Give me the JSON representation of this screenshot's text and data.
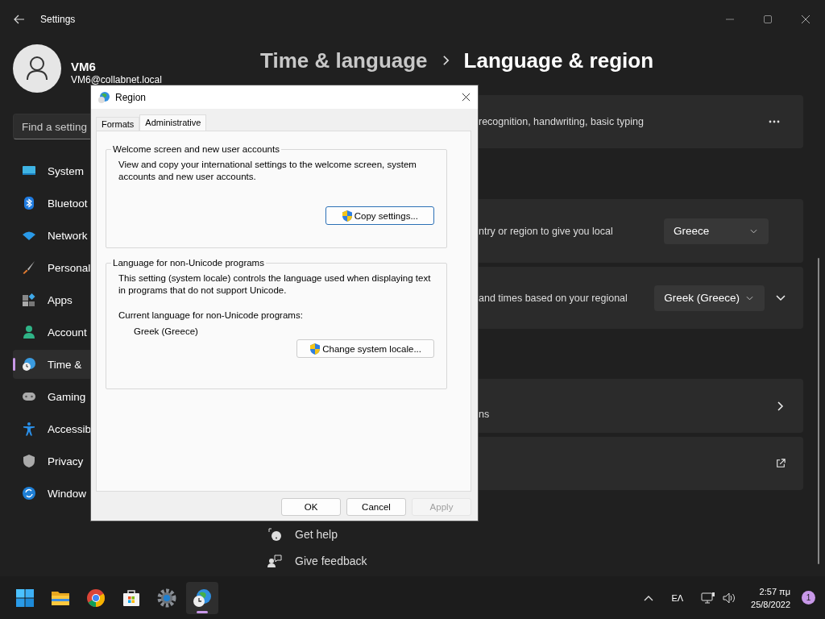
{
  "window": {
    "title": "Settings"
  },
  "user": {
    "name": "VM6",
    "email": "VM6@collabnet.local"
  },
  "search": {
    "placeholder": "Find a setting"
  },
  "nav": [
    {
      "label": "System",
      "kind": "system",
      "selected": false
    },
    {
      "label": "Bluetoot",
      "kind": "bluetooth",
      "selected": false
    },
    {
      "label": "Network",
      "kind": "network",
      "selected": false
    },
    {
      "label": "Personal",
      "kind": "brush",
      "selected": false
    },
    {
      "label": "Apps",
      "kind": "apps",
      "selected": false
    },
    {
      "label": "Account",
      "kind": "person",
      "selected": false
    },
    {
      "label": "Time &",
      "kind": "time",
      "selected": true
    },
    {
      "label": "Gaming",
      "kind": "gamepad",
      "selected": false
    },
    {
      "label": "Accessib",
      "kind": "accessibility",
      "selected": false
    },
    {
      "label": "Privacy",
      "kind": "shield",
      "selected": false
    },
    {
      "label": "Window",
      "kind": "update",
      "selected": false
    }
  ],
  "breadcrumb": [
    {
      "label": "Time & language",
      "current": false
    },
    {
      "label": "Language & region",
      "current": true
    }
  ],
  "cards": [
    {
      "text": "recognition, handwriting, basic typing",
      "kind": "more"
    },
    {
      "text": "ntry or region to give you local",
      "kind": "dropdown",
      "value": "Greece",
      "expandable": false
    },
    {
      "text": "and times based on your regional",
      "kind": "dropdown",
      "value": "Greek (Greece)",
      "expandable": true
    },
    {
      "text": "ns",
      "kind": "chevron"
    },
    {
      "kind": "external"
    }
  ],
  "links": [
    {
      "label": "Get help",
      "kind": "help"
    },
    {
      "label": "Give feedback",
      "kind": "feedback"
    }
  ],
  "dialog": {
    "title": "Region",
    "tabs": [
      {
        "label": "Formats",
        "selected": false
      },
      {
        "label": "Administrative",
        "selected": true
      }
    ],
    "groups": [
      {
        "legend": "Welcome screen and new user accounts",
        "description": "View and copy your international settings to the welcome screen, system accounts and new user accounts.",
        "button": {
          "label": "Copy settings...",
          "focused": true
        }
      },
      {
        "legend": "Language for non-Unicode programs",
        "description": "This setting (system locale) controls the language used when displaying text in programs that do not support Unicode.",
        "current_label": "Current language for non-Unicode programs:",
        "current_value": "Greek (Greece)",
        "button": {
          "label": "Change system locale...",
          "focused": false
        }
      }
    ],
    "buttons": [
      {
        "label": "OK",
        "disabled": false
      },
      {
        "label": "Cancel",
        "disabled": false
      },
      {
        "label": "Apply",
        "disabled": true
      }
    ]
  },
  "taskbar": {
    "apps": [
      {
        "kind": "start",
        "active": false
      },
      {
        "kind": "folder",
        "active": false
      },
      {
        "kind": "browser",
        "active": false
      },
      {
        "kind": "store",
        "active": false
      },
      {
        "kind": "gear",
        "active": false
      },
      {
        "kind": "globe-clock",
        "active": true
      }
    ],
    "language": "ΕΛ",
    "time": "2:57 πμ",
    "date": "25/8/2022",
    "notifications": "1"
  }
}
